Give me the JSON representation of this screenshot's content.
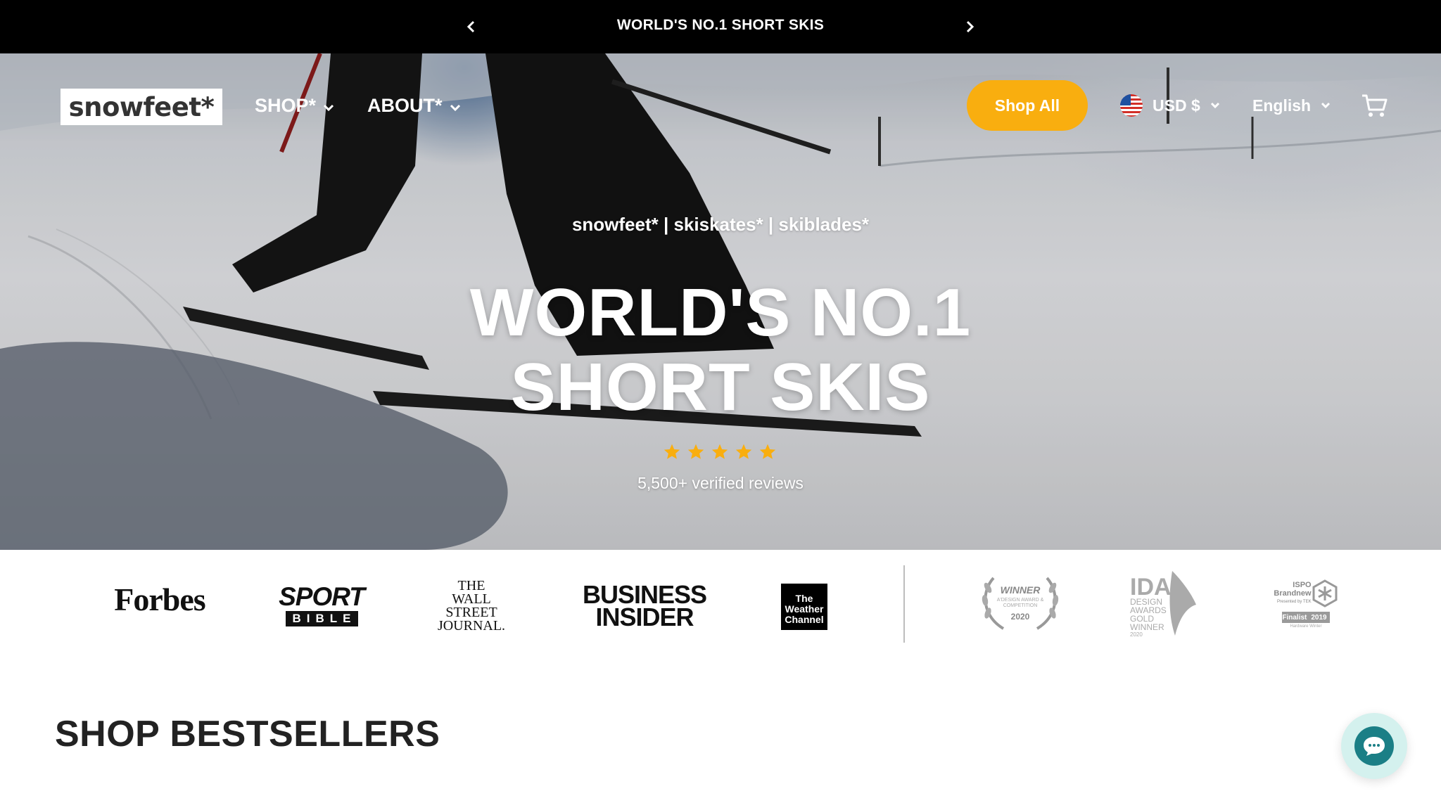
{
  "announcement": {
    "message": "WORLD'S NO.1 SHORT SKIS",
    "prev_icon": "chevron-left-icon",
    "next_icon": "chevron-right-icon"
  },
  "header": {
    "logo_text": "snowfeet*",
    "nav": [
      {
        "label": "SHOP*",
        "icon": "chevron-down-icon"
      },
      {
        "label": "ABOUT*",
        "icon": "chevron-down-icon"
      }
    ],
    "shop_all_label": "Shop All",
    "currency": {
      "label": "USD $",
      "flag": "us-flag-icon"
    },
    "language": {
      "label": "English"
    },
    "cart_icon": "cart-icon"
  },
  "hero": {
    "subtitle": "snowfeet* | skiskates* | skiblades*",
    "headline_line1": "WORLD'S NO.1",
    "headline_line2": "SHORT SKIS",
    "rating": 5,
    "reviews_text": "5,500+ verified reviews"
  },
  "press": {
    "logos": [
      "Forbes",
      "SPORT BIBLE",
      "THE WALL STREET JOURNAL",
      "BUSINESS INSIDER",
      "The Weather Channel"
    ],
    "forbes": "Forbes",
    "sportbible_top": "SPORT",
    "sportbible_bottom": "BIBLE",
    "wsj_line1": "THE",
    "wsj_line2": "WALL STREET",
    "wsj_line3": "JOURNAL.",
    "bi_line1": "BUSINESS",
    "bi_line2": "INSIDER",
    "weather_line1": "The",
    "weather_line2": "Weather",
    "weather_line3": "Channel",
    "award_a_title": "WINNER",
    "award_a_sub": "A'DESIGN AWARD & COMPETITION",
    "award_a_year": "2020",
    "ida_line1": "IDA",
    "ida_line2": "DESIGN",
    "ida_line3": "AWARDS",
    "ida_line4": "GOLD",
    "ida_line5": "WINNER",
    "ida_line6": "2020",
    "ispo_line1": "ISPO",
    "ispo_line2": "Brandnew",
    "ispo_line3": "Presented by TEK",
    "ispo_bar_label": "Finalist",
    "ispo_bar_year": "2019",
    "ispo_note": "Hardware Winter"
  },
  "section": {
    "title": "SHOP BESTSELLERS"
  },
  "chat": {
    "icon": "chat-bubble-icon"
  },
  "colors": {
    "accent": "#f9ae0f",
    "star": "#f9ae0f",
    "chat_teal": "#1b7f86"
  }
}
